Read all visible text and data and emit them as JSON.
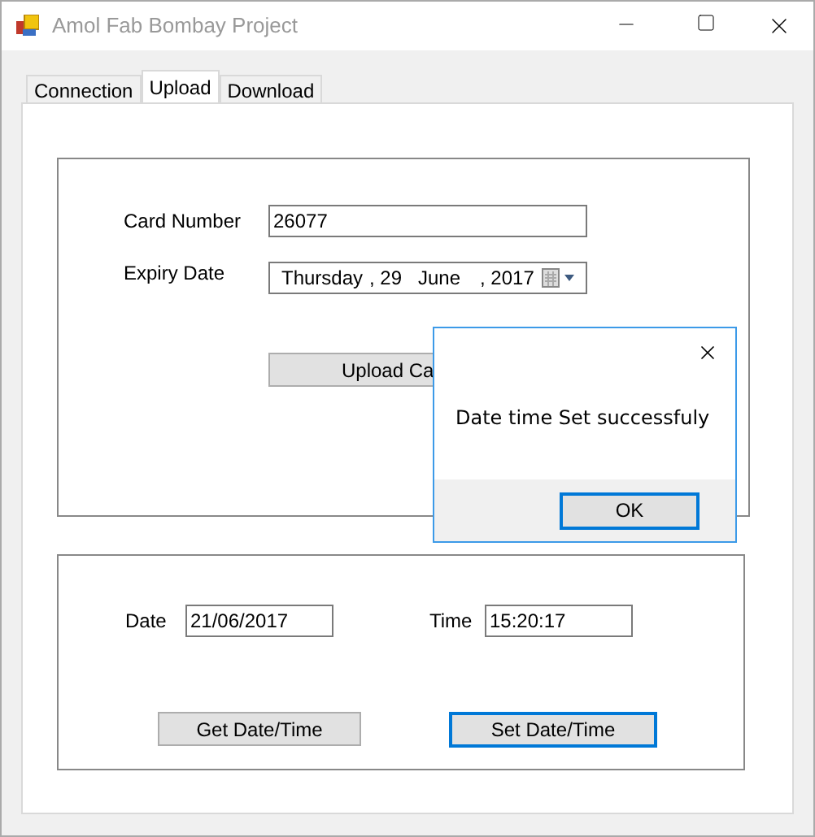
{
  "window": {
    "title": "Amol Fab Bombay Project"
  },
  "tabs": [
    {
      "label": "Connection",
      "selected": false
    },
    {
      "label": "Upload",
      "selected": true
    },
    {
      "label": "Download",
      "selected": false
    }
  ],
  "card_group": {
    "card_number_label": "Card Number",
    "card_number": "26077",
    "expiry_label": "Expiry Date",
    "expiry_date": {
      "weekday": "Thursday",
      "day": ", 29",
      "month": "June",
      "year": ", 2017"
    },
    "upload_button": "Upload Ca"
  },
  "datetime_group": {
    "date_label": "Date",
    "date": "21/06/2017",
    "time_label": "Time",
    "time": "15:20:17",
    "get_button": "Get Date/Time",
    "set_button": "Set Date/Time"
  },
  "dialog": {
    "message": "Date time Set successfuly",
    "ok_button": "OK"
  }
}
